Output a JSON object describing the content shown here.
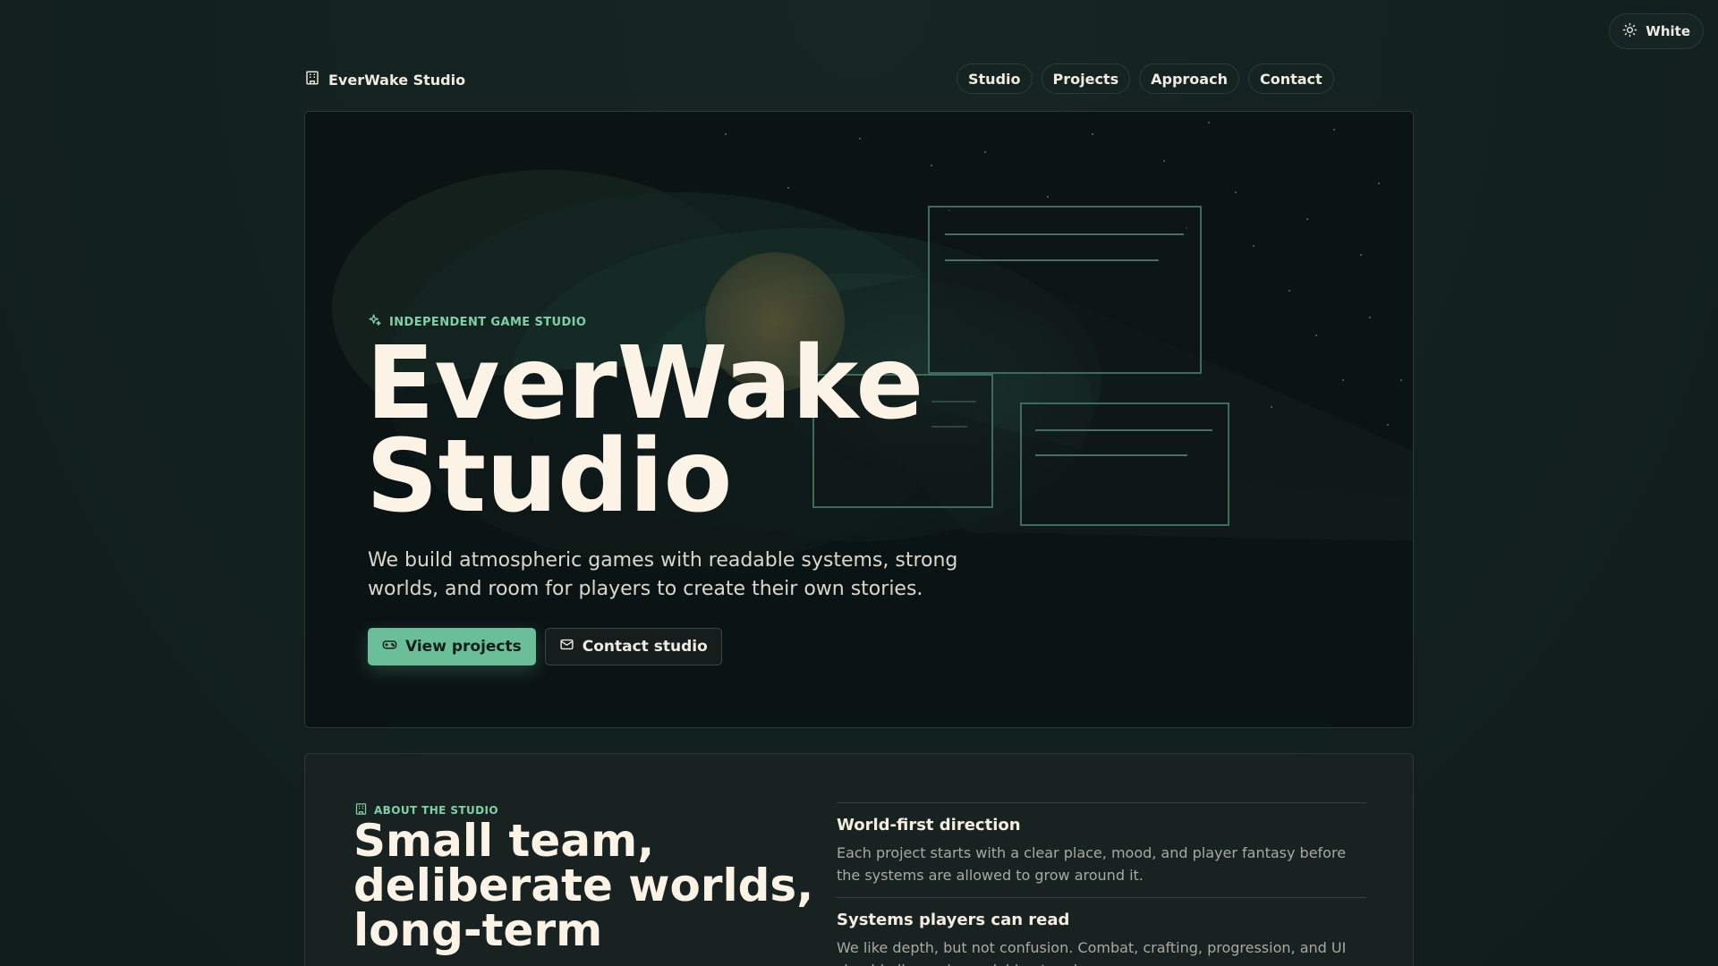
{
  "theme_toggle": {
    "label": "White",
    "icon": "sun-icon"
  },
  "brand": {
    "name": "EverWake Studio",
    "icon": "building-icon"
  },
  "nav": {
    "links": [
      {
        "label": "Studio"
      },
      {
        "label": "Projects"
      },
      {
        "label": "Approach"
      },
      {
        "label": "Contact"
      }
    ]
  },
  "hero": {
    "eyebrow": "INDEPENDENT GAME STUDIO",
    "eyebrow_icon": "sparkles-icon",
    "title_line1": "EverWake",
    "title_line2": "Studio",
    "subtitle": "We build atmospheric games with readable systems, strong worlds, and room for players to create their own stories.",
    "primary_button": {
      "label": "View projects",
      "icon": "gamepad-icon"
    },
    "secondary_button": {
      "label": "Contact studio",
      "icon": "mail-icon"
    }
  },
  "about": {
    "eyebrow": "ABOUT THE STUDIO",
    "eyebrow_icon": "building-icon",
    "title": "Small team, deliberate worlds, long-term",
    "features": [
      {
        "title": "World-first direction",
        "body": "Each project starts with a clear place, mood, and player fantasy before the systems are allowed to grow around it."
      },
      {
        "title": "Systems players can read",
        "body": "We like depth, but not confusion. Combat, crafting, progression, and UI should all remain readable at a glance."
      }
    ]
  },
  "colors": {
    "accent": "#7fd0a8",
    "primary_button": "#6bbf98",
    "title": "#fbf3e6",
    "background": "#142220"
  }
}
